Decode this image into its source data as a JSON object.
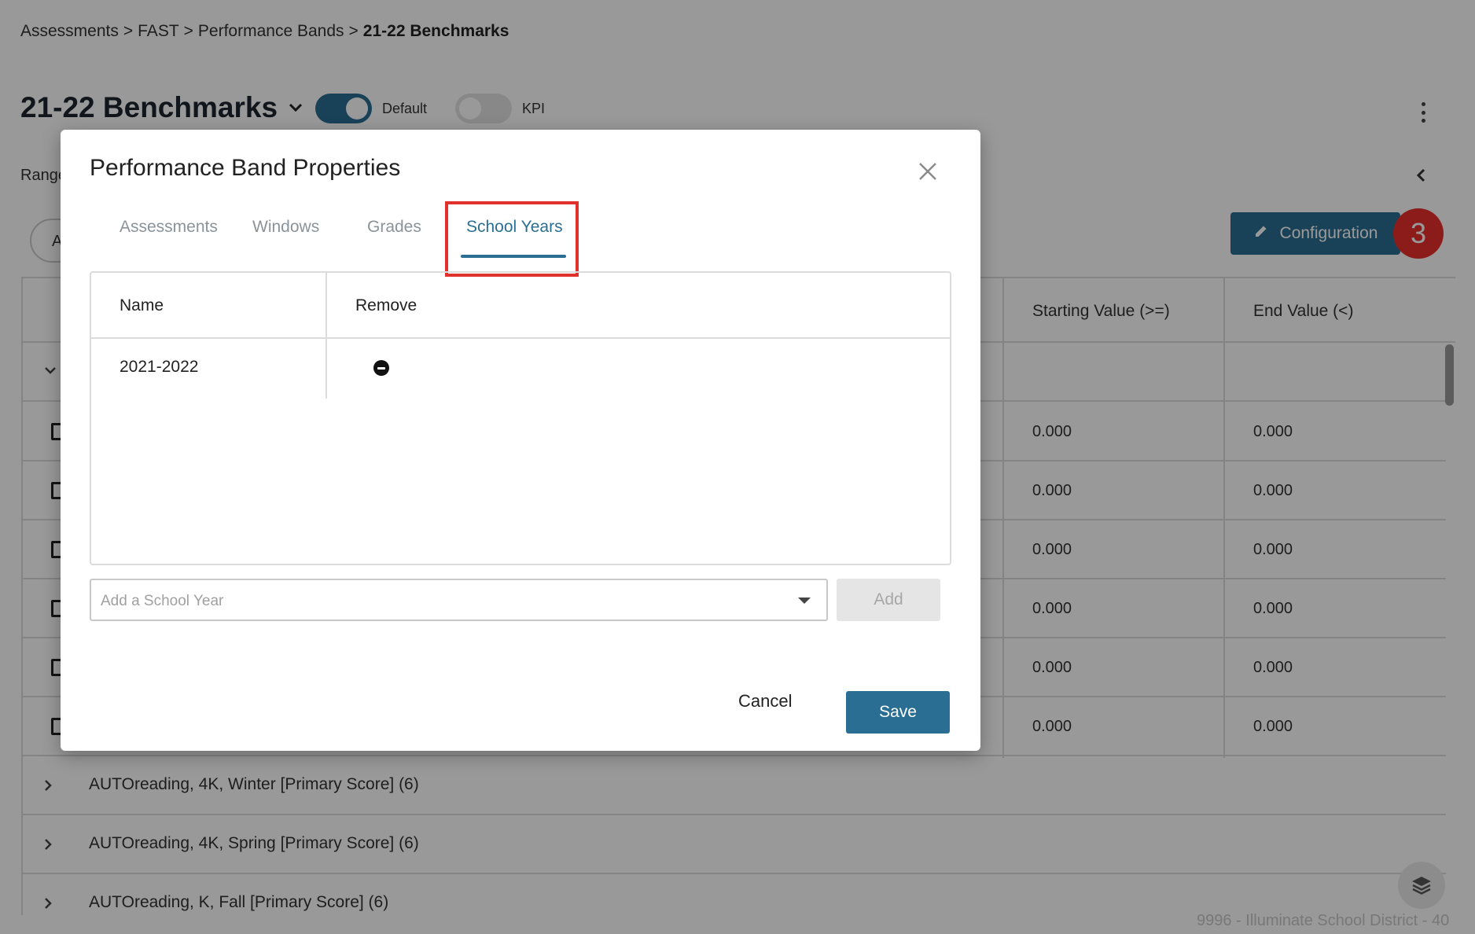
{
  "breadcrumb": {
    "items": [
      "Assessments",
      "FAST",
      "Performance Bands"
    ],
    "separator": ">",
    "current": "21-22 Benchmarks"
  },
  "header": {
    "title": "21-22 Benchmarks",
    "default_label": "Default",
    "default_on": true,
    "kpi_label": "KPI",
    "kpi_on": false,
    "range_label": "Range",
    "pill_letter": "A"
  },
  "toolbar": {
    "configuration_label": "Configuration",
    "step_badge": "3"
  },
  "grid": {
    "columns": [
      "Starting Value (>=)",
      "End Value (<)"
    ],
    "rows": [
      {
        "start": "0.000",
        "end": "0.000"
      },
      {
        "start": "0.000",
        "end": "0.000"
      },
      {
        "start": "0.000",
        "end": "0.000"
      },
      {
        "start": "0.000",
        "end": "0.000"
      },
      {
        "start": "0.000",
        "end": "0.000"
      },
      {
        "start": "0.000",
        "end": "0.000"
      }
    ],
    "groups": [
      "AUTOreading, 4K, Winter [Primary Score] (6)",
      "AUTOreading, 4K, Spring [Primary Score] (6)",
      "AUTOreading, K, Fall [Primary Score] (6)"
    ]
  },
  "footer": {
    "text": "9996 - Illuminate School District - 40"
  },
  "modal": {
    "title": "Performance Band Properties",
    "tabs": [
      "Assessments",
      "Windows",
      "Grades",
      "School Years"
    ],
    "active_tab": "School Years",
    "table": {
      "headers": [
        "Name",
        "Remove"
      ],
      "rows": [
        {
          "name": "2021-2022"
        }
      ]
    },
    "add": {
      "placeholder": "Add a School Year",
      "button_label": "Add"
    },
    "cancel_label": "Cancel",
    "save_label": "Save"
  },
  "colors": {
    "primary": "#2a6f93",
    "highlight": "#e0312c",
    "badge": "#e8302b"
  }
}
